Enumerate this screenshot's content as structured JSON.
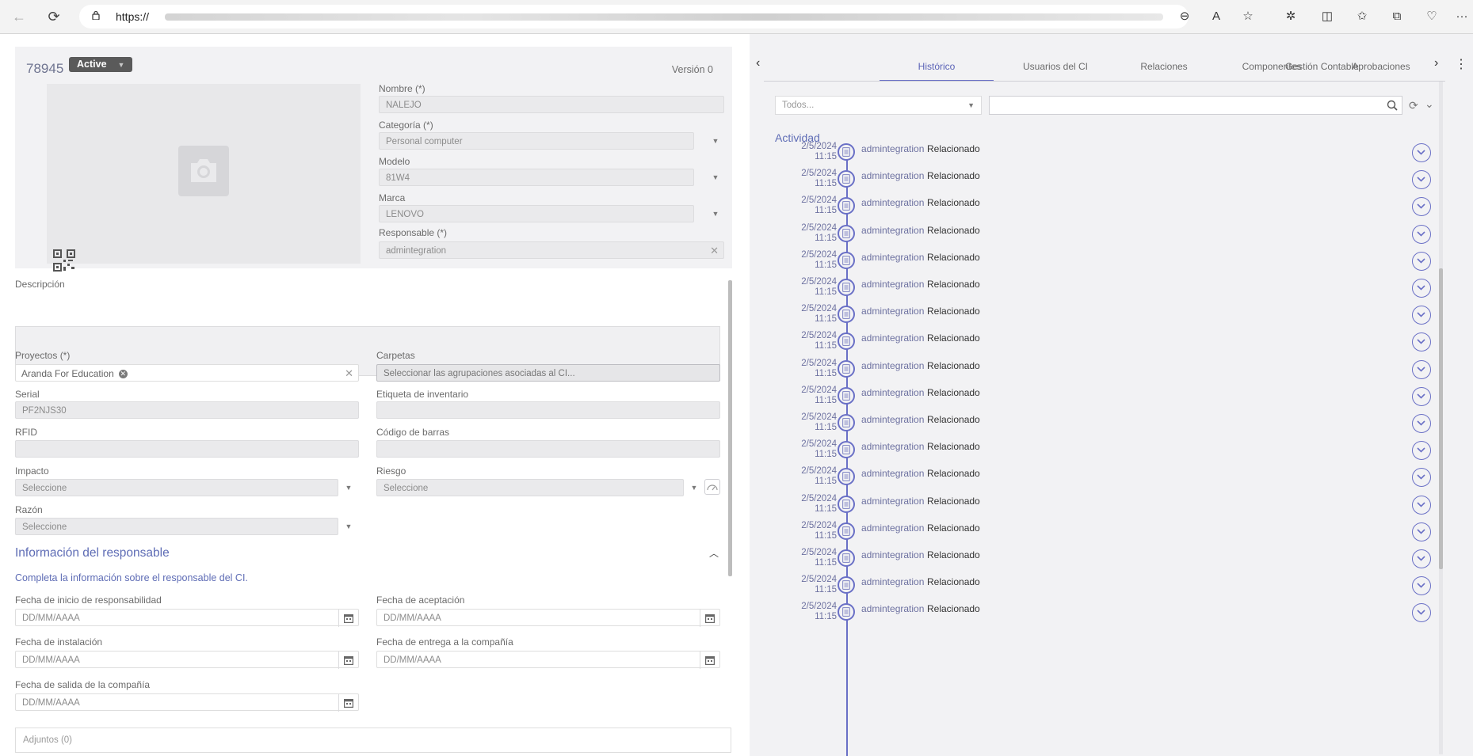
{
  "browser": {
    "url_prefix": "https://",
    "back_icon": "arrow-left-icon",
    "refresh_icon": "refresh-icon",
    "toolbar_icons": [
      "zoom-icon",
      "read-aloud-icon",
      "favorite-star-icon",
      "extensions-icon",
      "split-screen-icon",
      "favorites-icon",
      "collections-icon",
      "browser-essentials-icon",
      "more-icon"
    ],
    "more_label": "···"
  },
  "ci": {
    "id": "78945",
    "status": "Active",
    "version": "Versión 0"
  },
  "fields": {
    "nombre_label": "Nombre (*)",
    "nombre_value": "NALEJO",
    "categoria_label": "Categoría (*)",
    "categoria_value": "Personal computer",
    "modelo_label": "Modelo",
    "modelo_value": "81W4",
    "marca_label": "Marca",
    "marca_value": "LENOVO",
    "responsable_label": "Responsable (*)",
    "responsable_value": "admintegration",
    "descripcion_label": "Descripción",
    "proyectos_label": "Proyectos (*)",
    "proyectos_chip": "Aranda For Education",
    "carpetas_label": "Carpetas",
    "carpetas_placeholder": "Seleccionar las agrupaciones asociadas al CI...",
    "serial_label": "Serial",
    "serial_value": "PF2NJS30",
    "etiqueta_label": "Etiqueta de inventario",
    "rfid_label": "RFID",
    "codigo_label": "Código de barras",
    "impacto_label": "Impacto",
    "impacto_value": "Seleccione",
    "riesgo_label": "Riesgo",
    "riesgo_value": "Seleccione",
    "razon_label": "Razón",
    "razon_value": "Seleccione"
  },
  "responsable_section": {
    "title": "Información del responsable",
    "description": "Completa la información sobre el responsable del CI.",
    "fecha_inicio_label": "Fecha de inicio de responsabilidad",
    "fecha_aceptacion_label": "Fecha de aceptación",
    "fecha_instalacion_label": "Fecha de instalación",
    "fecha_entrega_label": "Fecha de entrega a la compañía",
    "fecha_salida_label": "Fecha de salida de la compañía",
    "date_placeholder": "DD/MM/AAAA"
  },
  "attachments_label": "Adjuntos (0)",
  "tabs": [
    "Histórico",
    "Usuarios del CI",
    "Relaciones",
    "Componentes",
    "Aprobaciones",
    "Gestión Contable"
  ],
  "filter": {
    "select_placeholder": "Todos..."
  },
  "activity": {
    "title": "Actividad",
    "entries": [
      {
        "date": "2/5/2024",
        "time": "11:15",
        "user": "admintegration",
        "action": "Relacionado"
      },
      {
        "date": "2/5/2024",
        "time": "11:15",
        "user": "admintegration",
        "action": "Relacionado"
      },
      {
        "date": "2/5/2024",
        "time": "11:15",
        "user": "admintegration",
        "action": "Relacionado"
      },
      {
        "date": "2/5/2024",
        "time": "11:15",
        "user": "admintegration",
        "action": "Relacionado"
      },
      {
        "date": "2/5/2024",
        "time": "11:15",
        "user": "admintegration",
        "action": "Relacionado"
      },
      {
        "date": "2/5/2024",
        "time": "11:15",
        "user": "admintegration",
        "action": "Relacionado"
      },
      {
        "date": "2/5/2024",
        "time": "11:15",
        "user": "admintegration",
        "action": "Relacionado"
      },
      {
        "date": "2/5/2024",
        "time": "11:15",
        "user": "admintegration",
        "action": "Relacionado"
      },
      {
        "date": "2/5/2024",
        "time": "11:15",
        "user": "admintegration",
        "action": "Relacionado"
      },
      {
        "date": "2/5/2024",
        "time": "11:15",
        "user": "admintegration",
        "action": "Relacionado"
      },
      {
        "date": "2/5/2024",
        "time": "11:15",
        "user": "admintegration",
        "action": "Relacionado"
      },
      {
        "date": "2/5/2024",
        "time": "11:15",
        "user": "admintegration",
        "action": "Relacionado"
      },
      {
        "date": "2/5/2024",
        "time": "11:15",
        "user": "admintegration",
        "action": "Relacionado"
      },
      {
        "date": "2/5/2024",
        "time": "11:15",
        "user": "admintegration",
        "action": "Relacionado"
      },
      {
        "date": "2/5/2024",
        "time": "11:15",
        "user": "admintegration",
        "action": "Relacionado"
      },
      {
        "date": "2/5/2024",
        "time": "11:15",
        "user": "admintegration",
        "action": "Relacionado"
      },
      {
        "date": "2/5/2024",
        "time": "11:15",
        "user": "admintegration",
        "action": "Relacionado"
      },
      {
        "date": "2/5/2024",
        "time": "11:15",
        "user": "admintegration",
        "action": "Relacionado"
      }
    ]
  },
  "colors": {
    "accent": "#5e6cb5",
    "timeline": "#6a70c6",
    "status_badge": "#5a5a5a"
  }
}
